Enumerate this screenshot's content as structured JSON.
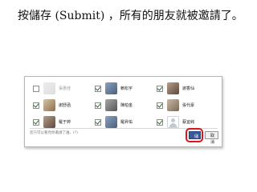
{
  "instruction": "按儲存 (Submit) ，所有的朋友就被邀請了。",
  "friends": [
    [
      {
        "name": "張惠佳",
        "checked": false
      },
      {
        "name": "賴松宇",
        "checked": true
      },
      {
        "name": "謝香仙",
        "checked": true
      }
    ],
    [
      {
        "name": "謝舒函",
        "checked": true
      },
      {
        "name": "陳柏金",
        "checked": true
      },
      {
        "name": "張代豪",
        "checked": true
      }
    ],
    [
      {
        "name": "羅于婷",
        "checked": true
      },
      {
        "name": "羅昇佑",
        "checked": true
      },
      {
        "name": "蔡宜純",
        "checked": true
      }
    ]
  ],
  "footer": {
    "note": "您只可以看見你邀請了誰。(?)",
    "save_label": "儲存",
    "cancel_label": "取消"
  },
  "colors": {
    "highlight": "#d8141e",
    "save_button": "#3b5998"
  }
}
